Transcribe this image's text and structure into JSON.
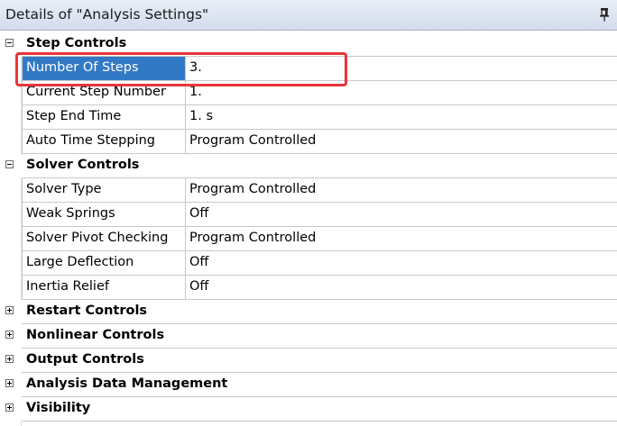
{
  "window": {
    "title": "Details of \"Analysis Settings\""
  },
  "groups": {
    "step_controls": {
      "label": "Step Controls",
      "expanded": true,
      "rows": [
        {
          "name": "Number Of Steps",
          "value": "3."
        },
        {
          "name": "Current Step Number",
          "value": "1."
        },
        {
          "name": "Step End Time",
          "value": "1. s"
        },
        {
          "name": "Auto Time Stepping",
          "value": "Program Controlled"
        }
      ]
    },
    "solver_controls": {
      "label": "Solver Controls",
      "expanded": true,
      "rows": [
        {
          "name": "Solver Type",
          "value": "Program Controlled"
        },
        {
          "name": "Weak Springs",
          "value": "Off"
        },
        {
          "name": "Solver Pivot Checking",
          "value": "Program Controlled"
        },
        {
          "name": "Large Deflection",
          "value": "Off"
        },
        {
          "name": "Inertia Relief",
          "value": "Off"
        }
      ]
    },
    "restart_controls": {
      "label": "Restart Controls",
      "expanded": false
    },
    "nonlinear_controls": {
      "label": "Nonlinear Controls",
      "expanded": false
    },
    "output_controls": {
      "label": "Output Controls",
      "expanded": false
    },
    "analysis_data_management": {
      "label": "Analysis Data Management",
      "expanded": false
    },
    "visibility": {
      "label": "Visibility",
      "expanded": false
    }
  },
  "colors": {
    "selection": "#3279c5",
    "highlight_border": "#e8353a",
    "grid_line": "#c9c9c9",
    "title_gradient_top": "#e9eef6",
    "title_gradient_bottom": "#d3dced"
  },
  "icons": {
    "pin": "pin-icon",
    "collapse": "collapse-box-icon",
    "expand": "expand-box-icon"
  },
  "selection": {
    "row": "Number Of Steps"
  }
}
